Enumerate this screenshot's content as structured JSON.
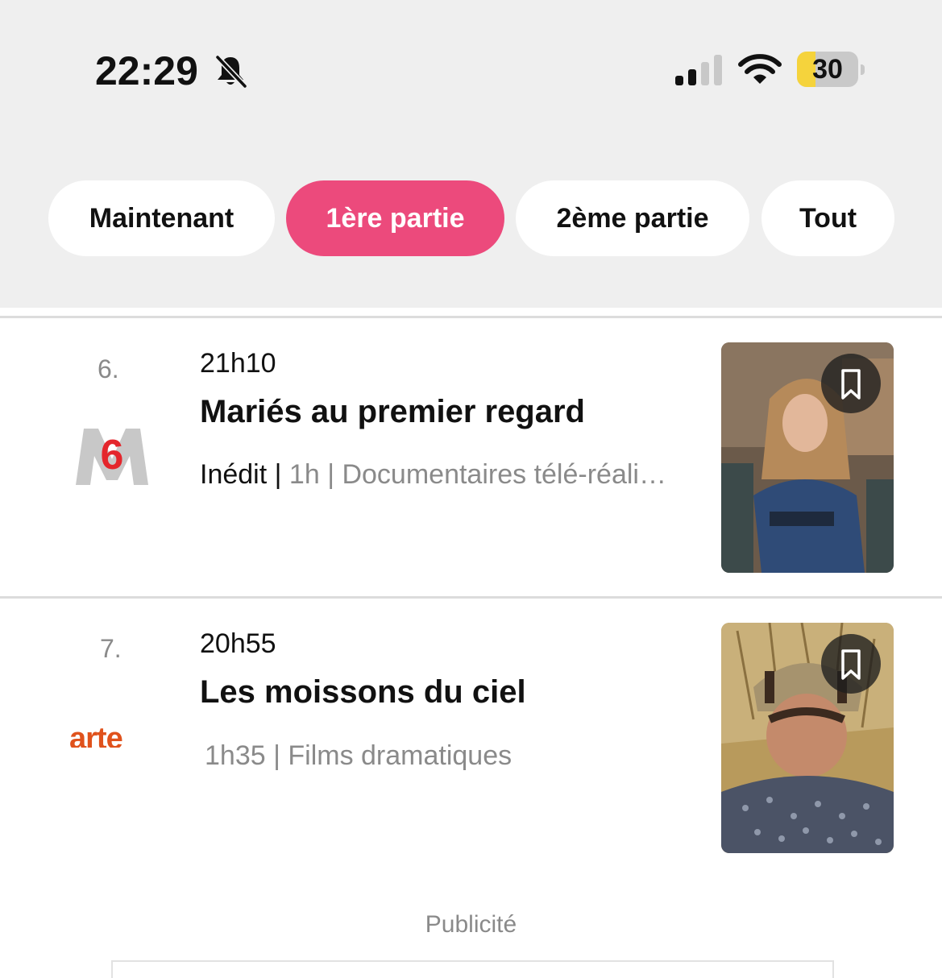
{
  "status_bar": {
    "time": "22:29",
    "battery_level": "30",
    "battery_fraction": 0.3,
    "icons": [
      "bell-slash-icon",
      "cellular-signal-icon",
      "wifi-icon",
      "battery-icon"
    ]
  },
  "tabs": [
    {
      "label": "Maintenant",
      "active": false
    },
    {
      "label": "1ère partie",
      "active": true
    },
    {
      "label": "2ème partie",
      "active": false
    },
    {
      "label": "Tout",
      "active": false
    }
  ],
  "programs": [
    {
      "rank": "6.",
      "channel": "M6",
      "channel_logo_text": "6",
      "time": "21h10",
      "title": "Mariés au premier regard",
      "badge": "Inédit |",
      "duration": "1h",
      "genre": "| Documentaires télé-réali…",
      "thumbnail_icon": "bookmark-icon"
    },
    {
      "rank": "7.",
      "channel": "arte",
      "channel_logo_text": "arte",
      "time": "20h55",
      "title": "Les moissons du ciel",
      "badge": "",
      "duration": "1h35",
      "genre": "| Films dramatiques",
      "thumbnail_icon": "bookmark-icon"
    }
  ],
  "ad": {
    "label": "Publicité"
  },
  "colors": {
    "accent": "#ec4a7c",
    "background_top": "#efefef",
    "text_primary": "#111111",
    "text_secondary": "#8a8a8a",
    "battery_fill": "#f5d33c",
    "arte_orange": "#e0521c",
    "m6_red": "#e4262c"
  }
}
